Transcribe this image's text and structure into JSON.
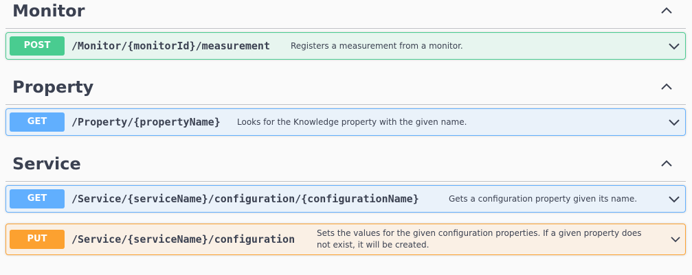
{
  "sections": [
    {
      "title": "Monitor",
      "operations": [
        {
          "method": "POST",
          "path": "/Monitor/{monitorId}/measurement",
          "summary": "Registers a measurement from a monitor."
        }
      ]
    },
    {
      "title": "Property",
      "operations": [
        {
          "method": "GET",
          "path": "/Property/{propertyName}",
          "summary": "Looks for the Knowledge property with the given name."
        }
      ]
    },
    {
      "title": "Service",
      "operations": [
        {
          "method": "GET",
          "path": "/Service/{serviceName}/configuration/{configurationName}",
          "summary": "Gets a configuration property given its name."
        },
        {
          "method": "PUT",
          "path": "/Service/{serviceName}/configuration",
          "summary_line1": "Sets the values for the given configuration properties. If a given property does",
          "summary_line2": "not exist, it will be created."
        }
      ]
    }
  ],
  "colors": {
    "post": "#49cc90",
    "get": "#61affe",
    "put": "#fca130",
    "text": "#3b4151"
  }
}
